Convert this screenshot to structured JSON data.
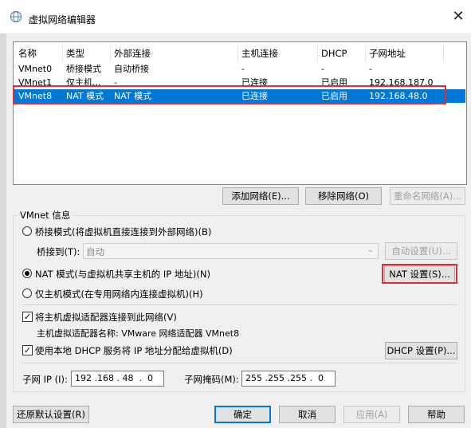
{
  "window": {
    "title": "虚拟网络编辑器",
    "close": "✕"
  },
  "table": {
    "headers": [
      "名称",
      "类型",
      "外部连接",
      "主机连接",
      "DHCP",
      "子网地址"
    ],
    "rows": [
      {
        "name": "VMnet0",
        "type": "桥接模式",
        "external": "自动桥接",
        "host": "-",
        "dhcp": "-",
        "subnet": "-",
        "selected": false
      },
      {
        "name": "VMnet1",
        "type": "仅主机...",
        "external": "-",
        "host": "已连接",
        "dhcp": "已启用",
        "subnet": "192.168.187.0",
        "selected": false
      },
      {
        "name": "VMnet8",
        "type": "NAT 模式",
        "external": "NAT 模式",
        "host": "已连接",
        "dhcp": "已启用",
        "subnet": "192.168.48.0",
        "selected": true
      }
    ]
  },
  "list_buttons": {
    "add": "添加网络(E)...",
    "remove": "移除网络(O)",
    "rename": "重命名网络(A)..."
  },
  "vmnet_info": {
    "group_label": "VMnet 信息",
    "bridge_radio": "桥接模式(将虚拟机直接连接到外部网络)(B)",
    "bridge_to_label": "桥接到(T):",
    "bridge_to_value": "自动",
    "auto_settings": "自动设置(U)...",
    "nat_radio": "NAT 模式(与虚拟机共享主机的 IP 地址)(N)",
    "nat_settings": "NAT 设置(S)...",
    "hostonly_radio": "仅主机模式(在专用网络内连接虚拟机)(H)",
    "connect_adapter": "将主机虚拟适配器连接到此网络(V)",
    "adapter_name": "主机虚拟适配器名称: VMware 网络适配器 VMnet8",
    "use_dhcp": "使用本地 DHCP 服务将 IP 地址分配给虚拟机(D)",
    "dhcp_settings": "DHCP 设置(P)...",
    "subnet_ip_label": "子网 IP (I):",
    "subnet_ip": "192 .168 . 48  .  0",
    "subnet_mask_label": "子网掩码(M):",
    "subnet_mask": "255 .255 .255 .  0"
  },
  "footer": {
    "restore": "还原默认设置(R)",
    "ok": "确定",
    "cancel": "取消",
    "apply": "应用(A)",
    "help": "帮助"
  },
  "colors": {
    "selection": "#0078d7",
    "highlight_outline": "#e02f2f"
  },
  "icons": {
    "app": "network-globe-icon",
    "close": "close-icon",
    "combo_arrow": "chevron-down-icon"
  }
}
